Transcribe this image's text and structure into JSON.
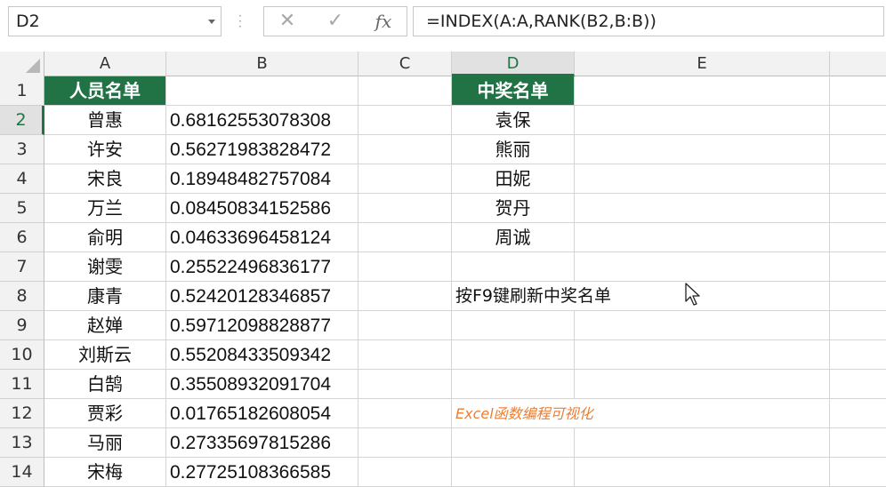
{
  "formula_bar": {
    "name_box": "D2",
    "cancel_glyph": "✕",
    "enter_glyph": "✓",
    "fx_label": "fx",
    "formula": "=INDEX(A:A,RANK(B2,B:B))"
  },
  "columns": [
    "A",
    "B",
    "C",
    "D",
    "E"
  ],
  "rows": [
    {
      "num": "1",
      "a": "人员名单",
      "b": "",
      "d": "中奖名单"
    },
    {
      "num": "2",
      "a": "曾惠",
      "b": "0.68162553078308",
      "d": "袁保"
    },
    {
      "num": "3",
      "a": "许安",
      "b": "0.56271983828472",
      "d": "熊丽"
    },
    {
      "num": "4",
      "a": "宋良",
      "b": "0.18948482757084",
      "d": "田妮"
    },
    {
      "num": "5",
      "a": "万兰",
      "b": "0.08450834152586",
      "d": "贺丹"
    },
    {
      "num": "6",
      "a": "俞明",
      "b": "0.04633696458124",
      "d": "周诚"
    },
    {
      "num": "7",
      "a": "谢雯",
      "b": "0.25522496836177",
      "d": ""
    },
    {
      "num": "8",
      "a": "康青",
      "b": "0.52420128346857",
      "d": "按F9键刷新中奖名单"
    },
    {
      "num": "9",
      "a": "赵婵",
      "b": "0.59712098828877",
      "d": ""
    },
    {
      "num": "10",
      "a": "刘斯云",
      "b": "0.55208433509342",
      "d": ""
    },
    {
      "num": "11",
      "a": "白鹄",
      "b": "0.35508932091704",
      "d": ""
    },
    {
      "num": "12",
      "a": "贾彩",
      "b": "0.01765182608054",
      "d": "Excel函数编程可视化"
    },
    {
      "num": "13",
      "a": "马丽",
      "b": "0.27335697815286",
      "d": ""
    },
    {
      "num": "14",
      "a": "宋梅",
      "b": "0.27725108366585",
      "d": ""
    }
  ],
  "colors": {
    "header_green": "#217346",
    "watermark_orange": "#ed7d31"
  }
}
